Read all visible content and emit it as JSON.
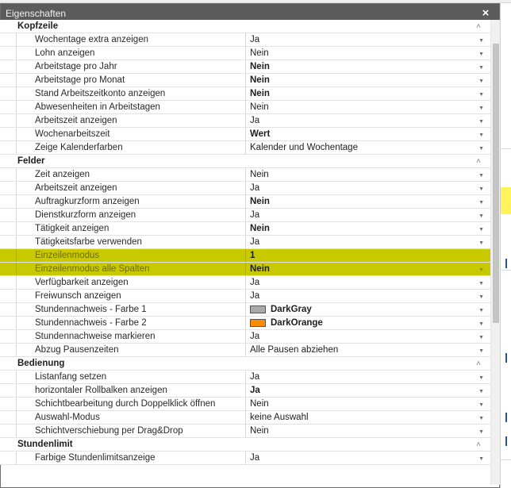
{
  "window": {
    "title": "Eigenschaften",
    "close_glyph": "×"
  },
  "categories": [
    {
      "label": "Kopfzeile",
      "rows": [
        {
          "name": "Wochentage extra anzeigen",
          "value": "Ja",
          "bold": false
        },
        {
          "name": "Lohn anzeigen",
          "value": "Nein",
          "bold": false
        },
        {
          "name": "Arbeitstage pro Jahr",
          "value": "Nein",
          "bold": true
        },
        {
          "name": "Arbeitstage pro Monat",
          "value": "Nein",
          "bold": true
        },
        {
          "name": "Stand Arbeitszeitkonto anzeigen",
          "value": "Nein",
          "bold": true
        },
        {
          "name": "Abwesenheiten in Arbeitstagen",
          "value": "Nein",
          "bold": false
        },
        {
          "name": "Arbeitszeit anzeigen",
          "value": "Ja",
          "bold": false
        },
        {
          "name": "Wochenarbeitszeit",
          "value": "Wert",
          "bold": true
        },
        {
          "name": "Zeige Kalenderfarben",
          "value": "Kalender und Wochentage",
          "bold": false
        }
      ]
    },
    {
      "label": "Felder",
      "rows": [
        {
          "name": "Zeit anzeigen",
          "value": "Nein",
          "bold": false
        },
        {
          "name": "Arbeitszeit anzeigen",
          "value": "Ja",
          "bold": false
        },
        {
          "name": "Auftragkurzform anzeigen",
          "value": "Nein",
          "bold": true
        },
        {
          "name": "Dienstkurzform anzeigen",
          "value": "Ja",
          "bold": false
        },
        {
          "name": "Tätigkeit anzeigen",
          "value": "Nein",
          "bold": true
        },
        {
          "name": "Tätigkeitsfarbe verwenden",
          "value": "Ja",
          "bold": false
        },
        {
          "name": "Einzeilenmodus",
          "value": "1",
          "bold": true,
          "highlight": true,
          "no_dropdown": true
        },
        {
          "name": "Einzeilenmodus alle Spalten",
          "value": "Nein",
          "bold": true,
          "highlight": true
        },
        {
          "name": "Verfügbarkeit anzeigen",
          "value": "Ja",
          "bold": false
        },
        {
          "name": "Freiwunsch anzeigen",
          "value": "Ja",
          "bold": false
        },
        {
          "name": "Stundennachweis - Farbe 1",
          "value": "DarkGray",
          "bold": true,
          "swatch": "#a9a9a9"
        },
        {
          "name": "Stundennachweis - Farbe 2",
          "value": "DarkOrange",
          "bold": true,
          "swatch": "#ff8c00"
        },
        {
          "name": "Stundennachweise markieren",
          "value": "Ja",
          "bold": false
        },
        {
          "name": "Abzug Pausenzeiten",
          "value": "Alle Pausen abziehen",
          "bold": false
        }
      ]
    },
    {
      "label": "Bedienung",
      "rows": [
        {
          "name": "Listanfang setzen",
          "value": "Ja",
          "bold": false
        },
        {
          "name": "horizontaler Rollbalken anzeigen",
          "value": "Ja",
          "bold": true
        },
        {
          "name": "Schichtbearbeitung durch Doppelklick öffnen",
          "value": "Nein",
          "bold": false
        },
        {
          "name": "Auswahl-Modus",
          "value": "keine Auswahl",
          "bold": false
        },
        {
          "name": "Schichtverschiebung per Drag&Drop",
          "value": "Nein",
          "bold": false
        }
      ]
    },
    {
      "label": "Stundenlimit",
      "rows": [
        {
          "name": "Farbige Stundenlimitsanzeige",
          "value": "Ja",
          "bold": false
        }
      ]
    }
  ],
  "icons": {
    "collapse": "chevron-up-icon",
    "dropdown": "dropdown-arrow-icon",
    "close": "close-icon"
  },
  "colors": {
    "highlight": "#c9c900",
    "titlebar": "#5b5b5b"
  }
}
